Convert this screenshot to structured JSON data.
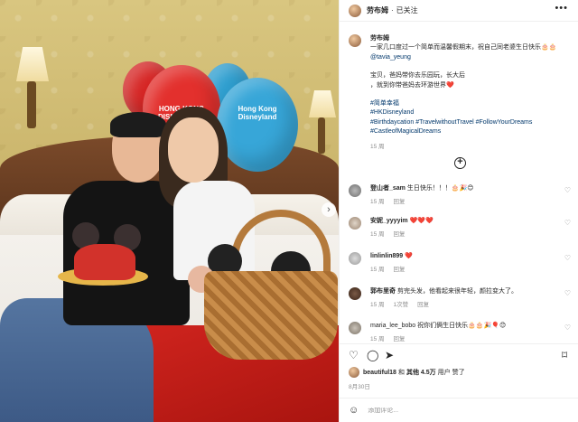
{
  "post": {
    "username": "劳布姆",
    "follow_status": "已关注",
    "more_icon": "more-horizontal-icon"
  },
  "photo": {
    "balloon_text_1": "HONG KONG DISNEYLAND",
    "balloon_text_2": "Hong Kong Disneyland"
  },
  "caption": {
    "username": "劳布姆",
    "line1": "一家几口度过一个简单而温馨假期末，祝自己同老婆生日快乐🎂🎂",
    "mention": "@tavia_yeung",
    "line2": "宝贝，爸妈带你去乐园玩，长大后",
    "line3": "，就到你带爸妈去环游世界❤️",
    "tag1": "#简单幸福",
    "tag2": "#HKDisneyland",
    "tag3": "#Birthdaycation",
    "tag4": "#TravelwithoutTravel",
    "tag5": "#FollowYourDreams",
    "tag6": "#CastleofMagicalDreams",
    "time": "15 周"
  },
  "comments": [
    {
      "user": "登山者_sam",
      "text": "生日快乐！！！🎂🎉😊",
      "time": "15 周",
      "reply": "回复",
      "likes": ""
    },
    {
      "user": "安妮_yyyyim",
      "text": "❤️❤️❤️",
      "time": "15 周",
      "reply": "回复",
      "likes": ""
    },
    {
      "user": "linlinlin899",
      "text": "❤️",
      "time": "15 周",
      "reply": "回复",
      "likes": ""
    },
    {
      "user": "郭布里奇",
      "text": "剪完头发，他看起来很年轻，颜拉变大了。",
      "time": "15 周",
      "reply": "回复",
      "likes": "1次赞"
    },
    {
      "user": "maria_lee_bobo",
      "text": "祝你们俩生日快乐🎂🎂🎉🎈😊",
      "time": "15 周",
      "reply": "回复",
      "likes": ""
    }
  ],
  "likes": {
    "liker": "beautiful18",
    "and": "和",
    "others": "其他 4.5万",
    "suffix": "用户 赞了"
  },
  "date": "8月30日",
  "add_comment": {
    "placeholder": "添加评论..."
  },
  "icons": [
    "heart-icon",
    "comment-icon",
    "share-icon",
    "bookmark-icon",
    "smile-icon",
    "plus-circle-icon",
    "chevron-right-icon"
  ]
}
